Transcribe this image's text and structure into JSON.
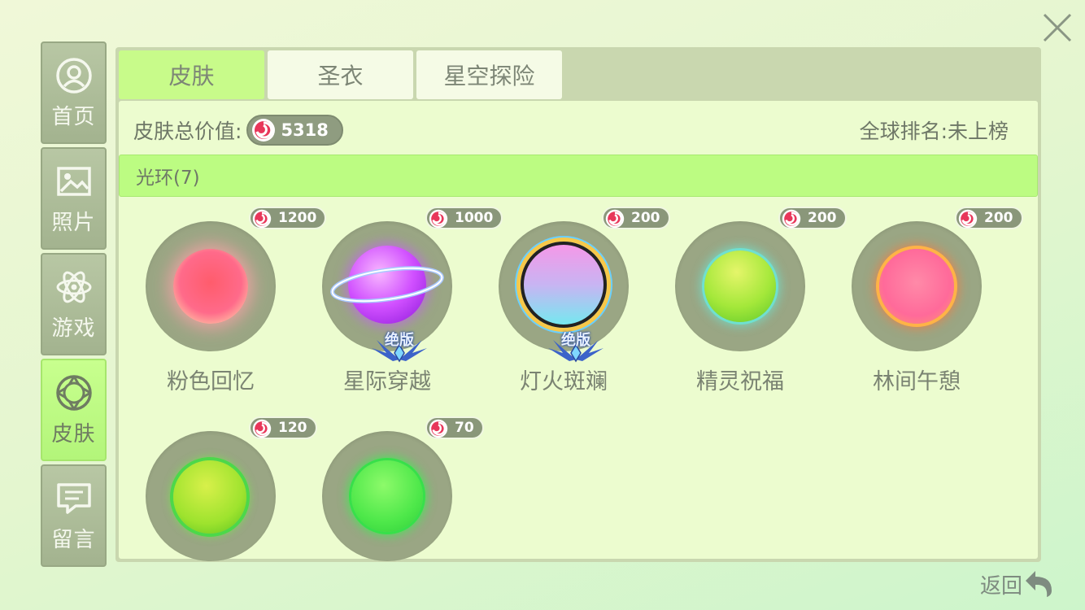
{
  "nav": {
    "items": [
      {
        "label": "首页",
        "icon": "profile-icon",
        "active": false
      },
      {
        "label": "照片",
        "icon": "photo-icon",
        "active": false
      },
      {
        "label": "游戏",
        "icon": "atom-icon",
        "active": false
      },
      {
        "label": "皮肤",
        "icon": "skin-icon",
        "active": true
      },
      {
        "label": "留言",
        "icon": "message-icon",
        "active": false
      }
    ]
  },
  "tabs": [
    {
      "label": "皮肤",
      "active": true
    },
    {
      "label": "圣衣",
      "active": false
    },
    {
      "label": "星空探险",
      "active": false
    }
  ],
  "summary": {
    "total_label": "皮肤总价值:",
    "total_value": "5318",
    "rank_text": "全球排名:未上榜"
  },
  "section": {
    "title": "光环(7)"
  },
  "items": [
    {
      "name": "粉色回忆",
      "price": "1200",
      "limited": false,
      "limited_label": ""
    },
    {
      "name": "星际穿越",
      "price": "1000",
      "limited": true,
      "limited_label": "绝版"
    },
    {
      "name": "灯火斑斓",
      "price": "200",
      "limited": true,
      "limited_label": "绝版"
    },
    {
      "name": "精灵祝福",
      "price": "200",
      "limited": false,
      "limited_label": ""
    },
    {
      "name": "林间午憩",
      "price": "200",
      "limited": false,
      "limited_label": ""
    },
    {
      "name": "",
      "price": "120",
      "limited": false,
      "limited_label": ""
    },
    {
      "name": "",
      "price": "70",
      "limited": false,
      "limited_label": ""
    }
  ],
  "footer": {
    "back_label": "返回"
  },
  "colors": {
    "accent_green": "#bcfc82",
    "panel": "#c9d7af",
    "disc": "#9aa684"
  }
}
